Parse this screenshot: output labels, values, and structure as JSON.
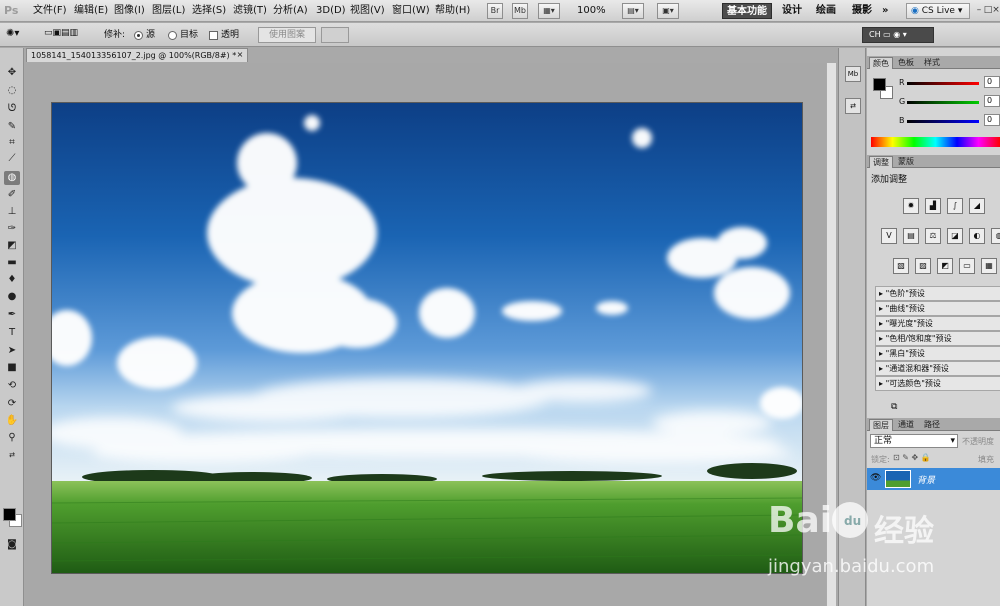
{
  "app": {
    "logo": "Ps",
    "menu": [
      "文件(F)",
      "编辑(E)",
      "图像(I)",
      "图层(L)",
      "选择(S)",
      "滤镜(T)",
      "分析(A)",
      "3D(D)",
      "视图(V)",
      "窗口(W)",
      "帮助(H)"
    ],
    "appbar": {
      "br": "Br",
      "mb": "Mb",
      "zoom": "100%"
    },
    "workspaces": {
      "active": "基本功能",
      "design": "设计",
      "paint": "绘画",
      "photo": "摄影",
      "more": "»"
    },
    "cs_live": "CS Live",
    "window_controls": {
      "minimize": "–",
      "restore": "□",
      "close": "×"
    }
  },
  "options": {
    "repair_label": "修补:",
    "source_label": "源",
    "target_label": "目标",
    "transparent_label": "透明",
    "use_pattern_label": "使用图案",
    "mini_label": "CH"
  },
  "document": {
    "tab_title": "1058141_154013356107_2.jpg @ 100%(RGB/8#) *",
    "close": "×"
  },
  "colors": {
    "accent": "#3b8ad9",
    "sky_top": "#0d3f86",
    "grass": "#3f9a2a"
  },
  "panels": {
    "color": {
      "tabs": [
        "颜色",
        "色板",
        "样式"
      ],
      "r_label": "R",
      "g_label": "G",
      "b_label": "B",
      "r_value": "0",
      "g_value": "0",
      "b_value": "0"
    },
    "adjustments": {
      "tabs": [
        "调整",
        "蒙版"
      ],
      "title": "添加调整",
      "presets": [
        "\"色阶\"预设",
        "\"曲线\"预设",
        "\"曝光度\"预设",
        "\"色相/饱和度\"预设",
        "\"黑白\"预设",
        "\"通道混和器\"预设",
        "\"可选颜色\"预设"
      ]
    },
    "layers": {
      "tabs": [
        "图层",
        "通道",
        "路径"
      ],
      "blend_mode": "正常",
      "opacity_label": "不透明度",
      "lock_label": "锁定:",
      "fill_label": "填充",
      "layer_name": "背景"
    }
  },
  "tools": [
    "move",
    "marquee",
    "lasso",
    "quick-select",
    "crop",
    "eyedropper",
    "patch",
    "brush",
    "stamp",
    "history-brush",
    "eraser",
    "gradient",
    "blur",
    "dodge",
    "pen",
    "type",
    "path-select",
    "shape",
    "3d-rotate",
    "3d-orbit",
    "hand",
    "zoom"
  ],
  "watermark": {
    "brand": "Bai",
    "brand_cn": "经验",
    "du": "du",
    "url": "jingyan.baidu.com"
  }
}
